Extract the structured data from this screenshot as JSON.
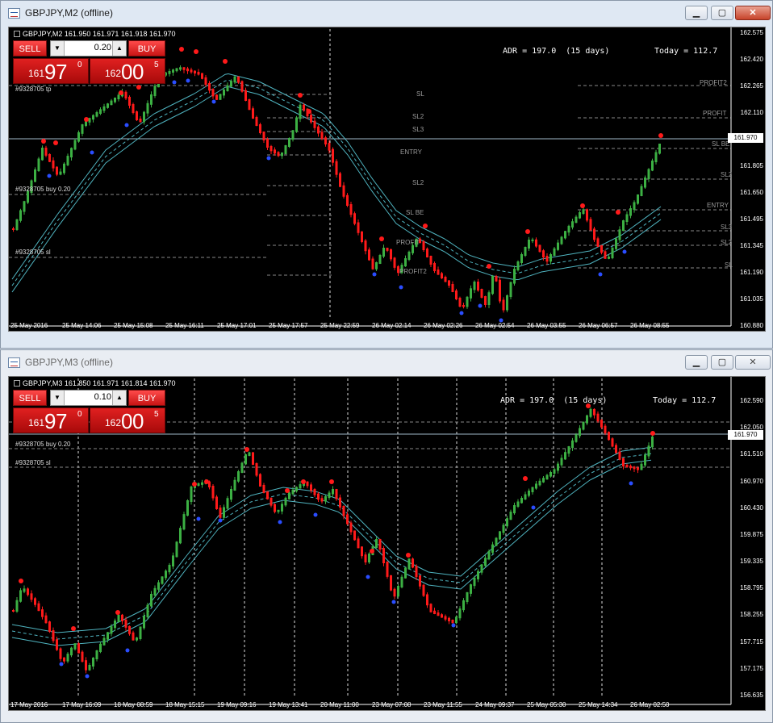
{
  "windows": [
    {
      "title": "GBPJPY,M2 (offline)",
      "active": true,
      "chart": {
        "symbol_line": "GBPJPY,M2  161.950 161.971 161.918 161.970",
        "trade_panel": {
          "sell_label": "SELL",
          "buy_label": "BUY",
          "lot": "0.20",
          "sell_small": "161",
          "sell_big": "97",
          "sell_sup": "0",
          "buy_small": "162",
          "buy_big": "00",
          "buy_sup": "5"
        },
        "adr_text": "ADR = 197.0  (15 days)",
        "today_text": "Today = 112.7",
        "order_labels": [
          "#9328705 tp",
          "#9328705 buy 0.20",
          "#9328705 sl"
        ],
        "current_price": "161.970",
        "price_axis": [
          "162.575",
          "162.420",
          "162.265",
          "162.110",
          "161.955",
          "161.805",
          "161.650",
          "161.495",
          "161.345",
          "161.190",
          "161.035",
          "160.880"
        ],
        "time_axis": [
          "25 May 2016",
          "25 May 14:06",
          "25 May 15:08",
          "25 May 16:11",
          "25 May 17:01",
          "25 May 17:57",
          "25 May 22:59",
          "26 May 02:14",
          "26 May 02:26",
          "26 May 02:54",
          "26 May 03:55",
          "26 May 06:57",
          "26 May 08:55"
        ],
        "level_labels": [
          "SL",
          "SL2",
          "SL3",
          "ENTRY",
          "SL2",
          "SL BE",
          "PROFIT",
          "PROFIT2",
          "PROFIT2",
          "PROFIT",
          "SL BE",
          "SL2",
          "ENTRY",
          "SL3",
          "SL2",
          "SL"
        ]
      }
    },
    {
      "title": "GBPJPY,M3 (offline)",
      "active": false,
      "chart": {
        "symbol_line": "GBPJPY,M3  161.850 161.971 161.814 161.970",
        "trade_panel": {
          "sell_label": "SELL",
          "buy_label": "BUY",
          "lot": "0.10",
          "sell_small": "161",
          "sell_big": "97",
          "sell_sup": "0",
          "buy_small": "162",
          "buy_big": "00",
          "buy_sup": "5"
        },
        "adr_text": "ADR = 197.0  (15 days)",
        "today_text": "Today = 112.7",
        "order_labels": [
          "#9328705 buy 0.20",
          "#9328705 sl"
        ],
        "current_price": "161.970",
        "price_axis": [
          "162.590",
          "162.050",
          "161.510",
          "160.970",
          "160.430",
          "159.875",
          "159.335",
          "158.795",
          "158.255",
          "157.715",
          "157.175",
          "156.635"
        ],
        "time_axis": [
          "17 May 2016",
          "17 May 16:09",
          "18 May 08:59",
          "18 May 15:15",
          "19 May 09:16",
          "19 May 13:41",
          "20 May 11:00",
          "23 May 07:08",
          "23 May 11:55",
          "24 May 09:37",
          "25 May 05:30",
          "25 May 14:34",
          "26 May 02:50"
        ]
      }
    }
  ],
  "colors": {
    "bull": "#3cb043",
    "bear": "#ff1a1a",
    "ma": "#4fb3bf",
    "grid": "#c8c8c8"
  }
}
